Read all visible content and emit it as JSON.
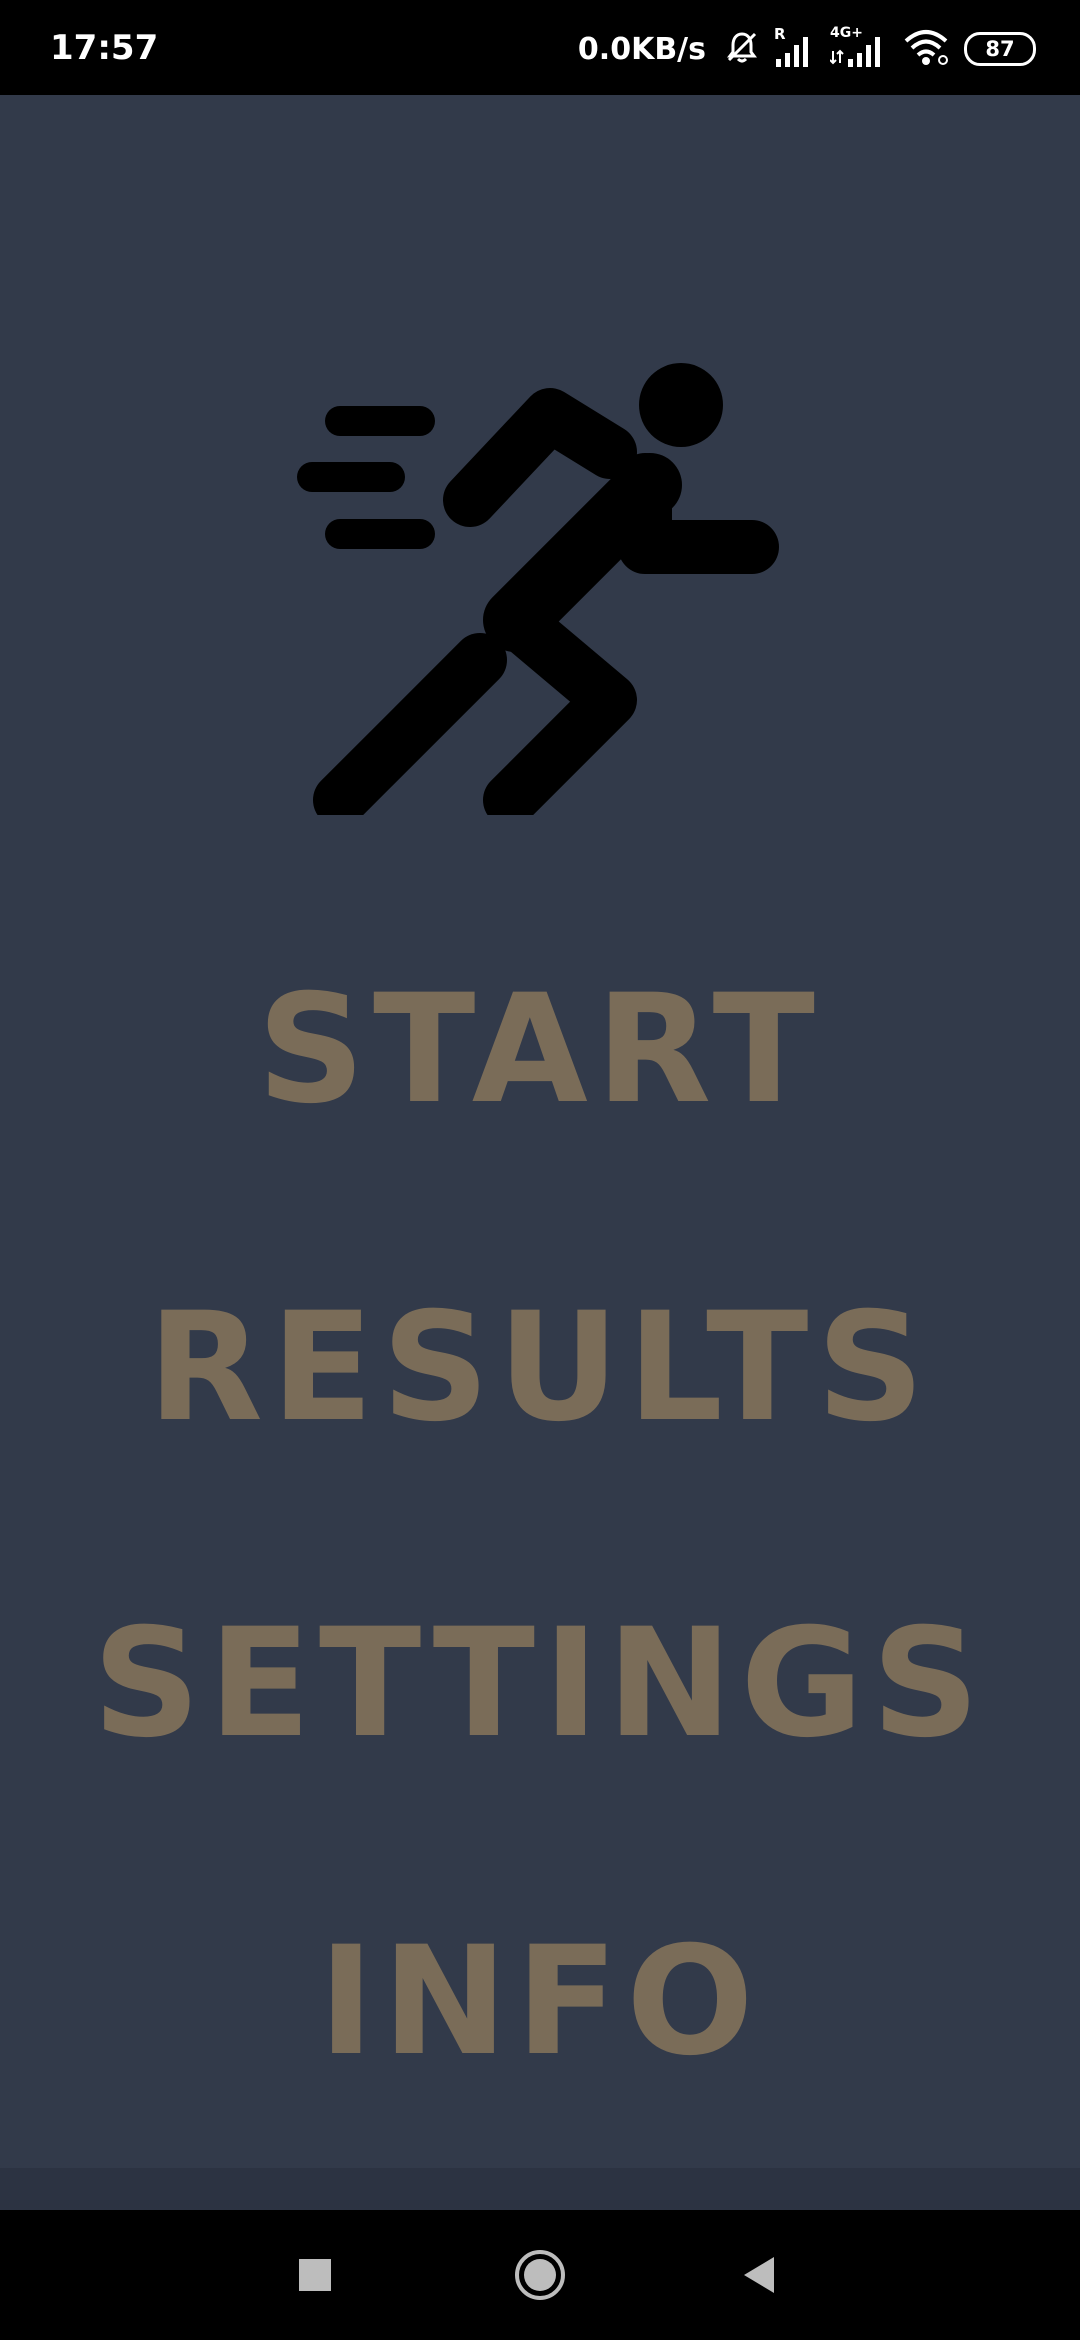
{
  "status_bar": {
    "time": "17:57",
    "network_speed": "0.0KB/s",
    "roaming_label": "R",
    "network_type": "4G+",
    "battery_level": "87",
    "icons": [
      "bell-muted-icon",
      "signal-roaming-icon",
      "signal-4g-icon",
      "wifi-icon",
      "battery-icon"
    ]
  },
  "app": {
    "logo_icon": "running-man-icon",
    "menu": [
      {
        "label": "START"
      },
      {
        "label": "RESULTS"
      },
      {
        "label": "SETTINGS"
      },
      {
        "label": "INFO"
      }
    ]
  },
  "navigation_bar": {
    "icons": [
      "recents-square-icon",
      "home-circle-icon",
      "back-triangle-icon"
    ]
  },
  "colors": {
    "background": "#323a4a",
    "menu_text": "#7a6c58",
    "status_bar": "#000000",
    "nav_bar": "#000000",
    "logo": "#000000"
  }
}
